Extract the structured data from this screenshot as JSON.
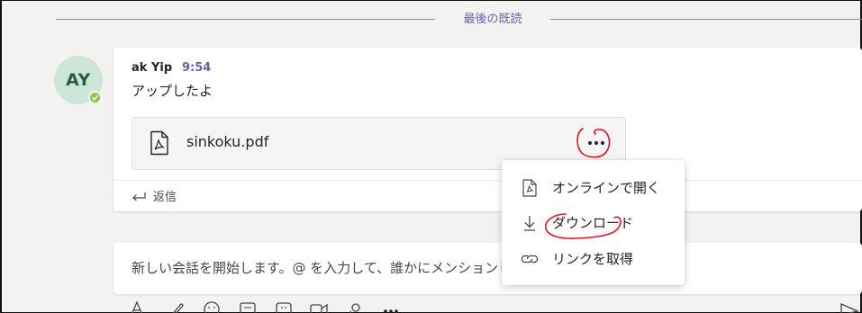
{
  "divider": {
    "label": "最後の既読"
  },
  "message": {
    "avatar_initials": "AY",
    "author": "ak Yip",
    "time": "9:54",
    "text": "アップしたよ",
    "attachment": {
      "file_name": "sinkoku.pdf",
      "icon": "pdf-file-icon"
    },
    "reply_label": "返信"
  },
  "compose": {
    "placeholder": "新しい会話を開始します。@ を入力して、誰かにメンションしてください。"
  },
  "context_menu": {
    "items": [
      {
        "label": "オンラインで開く",
        "icon": "pdf-file-icon"
      },
      {
        "label": "ダウンロード",
        "icon": "download-icon"
      },
      {
        "label": "リンクを取得",
        "icon": "link-icon"
      }
    ]
  },
  "colors": {
    "accent": "#6264a7",
    "background": "#f3f2f1",
    "presence": "#92c353",
    "annotation": "#e81123"
  },
  "toolbar": {
    "icons": [
      "format-icon",
      "attach-icon",
      "emoji-icon",
      "gif-icon",
      "sticker-icon",
      "meet-icon",
      "praise-icon",
      "more-options-icon",
      "send-icon"
    ]
  }
}
